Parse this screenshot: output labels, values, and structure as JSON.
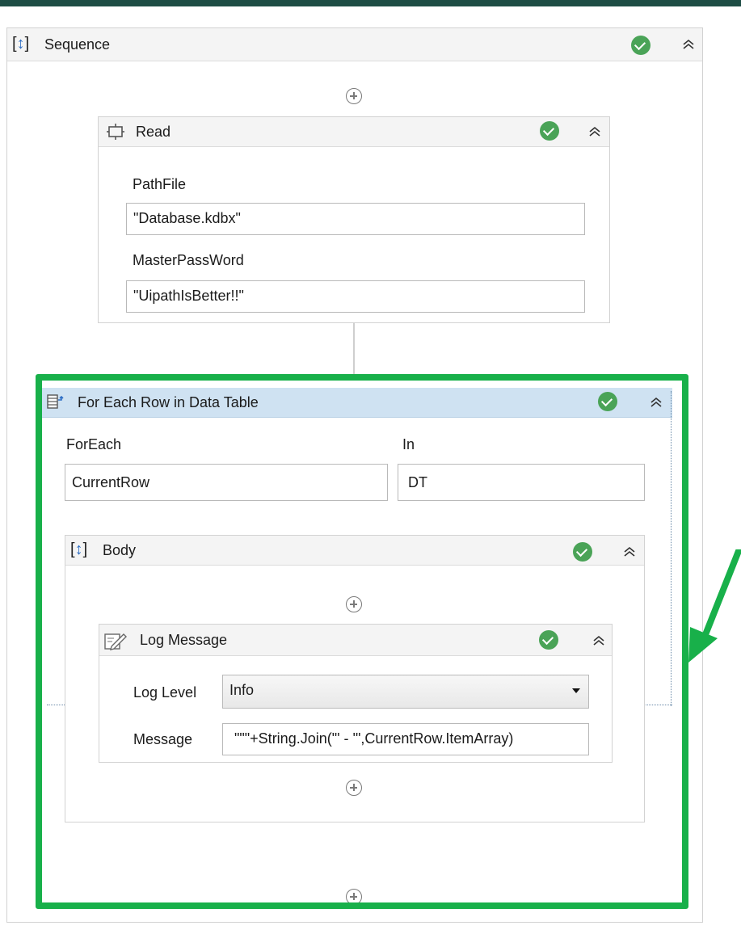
{
  "sequence": {
    "title": "Sequence"
  },
  "read": {
    "title": "Read",
    "path_label": "PathFile",
    "path_value": "\"Database.kdbx\"",
    "password_label": "MasterPassWord",
    "password_value": "\"UipathIsBetter!!\""
  },
  "for_each": {
    "title": "For Each Row in Data Table",
    "foreach_label": "ForEach",
    "foreach_value": "CurrentRow",
    "in_label": "In",
    "in_value": "DT"
  },
  "body": {
    "title": "Body"
  },
  "log_message": {
    "title": "Log Message",
    "level_label": "Log Level",
    "level_value": "Info",
    "message_label": "Message",
    "message_value": "\"\"\"+String.Join(\"' - '\",CurrentRow.ItemArray)"
  },
  "colors": {
    "highlight": "#18b04a",
    "success": "#4aa357",
    "selected_header": "#cfe2f2",
    "top_bar": "#1e4d45"
  },
  "icons": [
    "sequence-icon",
    "check-icon",
    "collapse-icon",
    "add-activity-icon",
    "read-icon",
    "datatable-icon",
    "log-message-icon",
    "dropdown-caret-icon",
    "arrow-icon"
  ]
}
